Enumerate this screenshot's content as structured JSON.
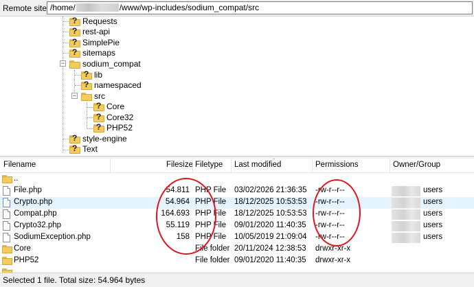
{
  "remote_site": {
    "label": "Remote site:",
    "path_prefix": "/home/",
    "path_suffix": "/www/wp-includes/sodium_compat/src"
  },
  "tree": {
    "nodes": [
      {
        "label": "Requests",
        "icon": "unknown-folder-icon"
      },
      {
        "label": "rest-api",
        "icon": "unknown-folder-icon"
      },
      {
        "label": "SimplePie",
        "icon": "unknown-folder-icon"
      },
      {
        "label": "sitemaps",
        "icon": "unknown-folder-icon"
      },
      {
        "label": "sodium_compat",
        "icon": "folder-icon",
        "expanded": true
      },
      {
        "label": "lib",
        "icon": "unknown-folder-icon"
      },
      {
        "label": "namespaced",
        "icon": "unknown-folder-icon"
      },
      {
        "label": "src",
        "icon": "folder-icon",
        "expanded": true
      },
      {
        "label": "Core",
        "icon": "unknown-folder-icon"
      },
      {
        "label": "Core32",
        "icon": "unknown-folder-icon"
      },
      {
        "label": "PHP52",
        "icon": "unknown-folder-icon"
      },
      {
        "label": "style-engine",
        "icon": "unknown-folder-icon"
      },
      {
        "label": "Text",
        "icon": "unknown-folder-icon"
      }
    ]
  },
  "columns": {
    "filename": "Filename",
    "filesize": "Filesize",
    "filetype": "Filetype",
    "last_modified": "Last modified",
    "permissions": "Permissions",
    "owner_group": "Owner/Group"
  },
  "files": [
    {
      "name": "..",
      "size": "",
      "type": "",
      "modified": "",
      "perms": "",
      "owner": "",
      "icon": "folder-icon"
    },
    {
      "name": "File.php",
      "size": "54.811",
      "type": "PHP File",
      "modified": "03/02/2026 21:36:35",
      "perms": "-rw-r--r--",
      "owner": "users",
      "icon": "file-icon"
    },
    {
      "name": "Crypto.php",
      "size": "54.964",
      "type": "PHP File",
      "modified": "18/12/2025 10:53:53",
      "perms": "-rw-r--r--",
      "owner": "users",
      "icon": "file-icon",
      "selected": true
    },
    {
      "name": "Compat.php",
      "size": "164.693",
      "type": "PHP File",
      "modified": "18/12/2025 10:53:53",
      "perms": "-rw-r--r--",
      "owner": "users",
      "icon": "file-icon"
    },
    {
      "name": "Crypto32.php",
      "size": "55.119",
      "type": "PHP File",
      "modified": "09/01/2020 11:40:35",
      "perms": "-rw-r--r--",
      "owner": "users",
      "icon": "file-icon"
    },
    {
      "name": "SodiumException.php",
      "size": "158",
      "type": "PHP File",
      "modified": "10/05/2019 21:09:04",
      "perms": "-rw-r--r--",
      "owner": "users",
      "icon": "file-icon"
    },
    {
      "name": "Core",
      "size": "",
      "type": "File folder",
      "modified": "20/11/2024 12:38:53",
      "perms": "drwxr-xr-x",
      "owner": "",
      "icon": "folder-icon"
    },
    {
      "name": "PHP52",
      "size": "",
      "type": "File folder",
      "modified": "09/01/2020 11:40:35",
      "perms": "drwxr-xr-x",
      "owner": "",
      "icon": "folder-icon"
    }
  ],
  "status": "Selected 1 file. Total size: 54.964 bytes",
  "colors": {
    "highlight_oval": "#e0141e",
    "selected_row": "#e5f3ff",
    "folder": "#f4cc5e"
  }
}
